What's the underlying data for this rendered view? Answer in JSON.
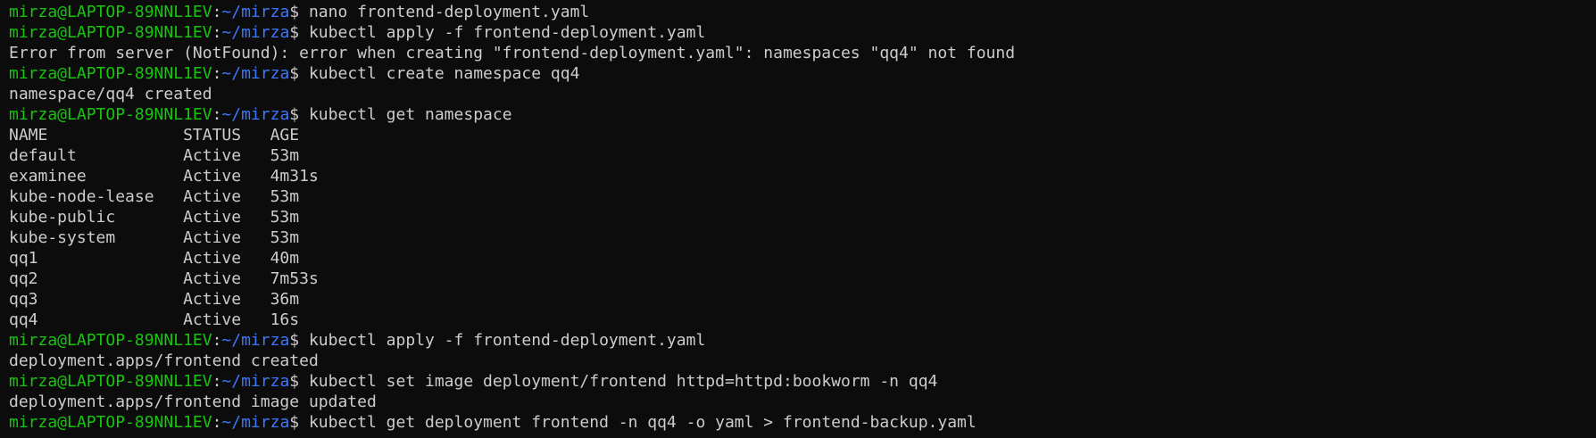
{
  "prompt": {
    "user_host": "mirza@LAPTOP-89NNL1EV",
    "separator": ":",
    "path": "~/mirza",
    "symbol": "$ "
  },
  "lines": [
    {
      "type": "cmd",
      "text": "nano frontend-deployment.yaml"
    },
    {
      "type": "cmd",
      "text": "kubectl apply -f frontend-deployment.yaml"
    },
    {
      "type": "out",
      "text": "Error from server (NotFound): error when creating \"frontend-deployment.yaml\": namespaces \"qq4\" not found"
    },
    {
      "type": "cmd",
      "text": "kubectl create namespace qq4"
    },
    {
      "type": "out",
      "text": "namespace/qq4 created"
    },
    {
      "type": "cmd",
      "text": "kubectl get namespace"
    },
    {
      "type": "out",
      "text": "NAME              STATUS   AGE"
    },
    {
      "type": "out",
      "text": "default           Active   53m"
    },
    {
      "type": "out",
      "text": "examinee          Active   4m31s"
    },
    {
      "type": "out",
      "text": "kube-node-lease   Active   53m"
    },
    {
      "type": "out",
      "text": "kube-public       Active   53m"
    },
    {
      "type": "out",
      "text": "kube-system       Active   53m"
    },
    {
      "type": "out",
      "text": "qq1               Active   40m"
    },
    {
      "type": "out",
      "text": "qq2               Active   7m53s"
    },
    {
      "type": "out",
      "text": "qq3               Active   36m"
    },
    {
      "type": "out",
      "text": "qq4               Active   16s"
    },
    {
      "type": "cmd",
      "text": "kubectl apply -f frontend-deployment.yaml"
    },
    {
      "type": "out",
      "text": "deployment.apps/frontend created"
    },
    {
      "type": "cmd",
      "text": "kubectl set image deployment/frontend httpd=httpd:bookworm -n qq4"
    },
    {
      "type": "out",
      "text": "deployment.apps/frontend image updated"
    },
    {
      "type": "cmd",
      "text": "kubectl get deployment frontend -n qq4 -o yaml > frontend-backup.yaml"
    }
  ],
  "colors": {
    "background": "#0c0c0c",
    "foreground": "#cccccc",
    "user_host": "#16c60c",
    "path": "#3b78ff"
  }
}
